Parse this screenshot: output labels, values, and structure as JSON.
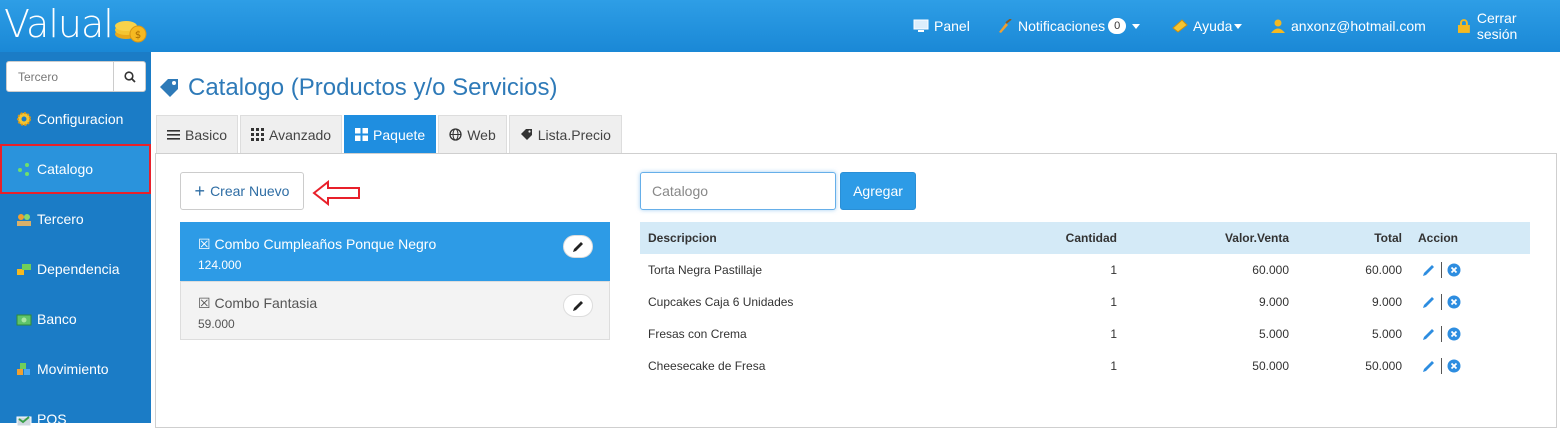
{
  "app": {
    "logo_text": "Valual"
  },
  "topnav": {
    "panel": "Panel",
    "notifications": "Notificaciones",
    "notifications_count": "0",
    "help": "Ayuda",
    "user": "anxonz@hotmail.com",
    "logout": "Cerrar sesión"
  },
  "sidebar": {
    "search_placeholder": "Tercero",
    "items": [
      {
        "label": "Configuracion",
        "icon": "gear-icon"
      },
      {
        "label": "Catalogo",
        "icon": "nodes-icon",
        "active": true
      },
      {
        "label": "Tercero",
        "icon": "people-icon"
      },
      {
        "label": "Dependencia",
        "icon": "blocks-icon"
      },
      {
        "label": "Banco",
        "icon": "bank-icon"
      },
      {
        "label": "Movimiento",
        "icon": "cubes-icon"
      },
      {
        "label": "POS",
        "icon": "pos-icon"
      }
    ]
  },
  "page": {
    "title": "Catalogo (Productos y/o Servicios)"
  },
  "tabs": [
    {
      "label": "Basico",
      "icon": "list-icon"
    },
    {
      "label": "Avanzado",
      "icon": "grid-icon"
    },
    {
      "label": "Paquete",
      "icon": "dashboard-icon",
      "active": true
    },
    {
      "label": "Web",
      "icon": "globe-icon"
    },
    {
      "label": "Lista.Precio",
      "icon": "tag-icon"
    }
  ],
  "packages": {
    "create_label": "Crear Nuevo",
    "items": [
      {
        "name": "Combo Cumpleaños Ponque Negro",
        "price": "124.000",
        "selected": true
      },
      {
        "name": "Combo Fantasia",
        "price": "59.000",
        "selected": false
      }
    ]
  },
  "detail": {
    "catalog_placeholder": "Catalogo",
    "add_label": "Agregar",
    "columns": [
      "Descripcion",
      "Cantidad",
      "Valor.Venta",
      "Total",
      "Accion"
    ],
    "rows": [
      {
        "descripcion": "Torta Negra Pastillaje",
        "cantidad": "1",
        "valor": "60.000",
        "total": "60.000"
      },
      {
        "descripcion": "Cupcakes Caja 6 Unidades",
        "cantidad": "1",
        "valor": "9.000",
        "total": "9.000"
      },
      {
        "descripcion": "Fresas con Crema",
        "cantidad": "1",
        "valor": "5.000",
        "total": "5.000"
      },
      {
        "descripcion": "Cheesecake de Fresa",
        "cantidad": "1",
        "valor": "50.000",
        "total": "50.000"
      }
    ]
  },
  "colors": {
    "topbar": "#1a88d6",
    "sidebar": "#1b7cc6",
    "accent": "#2d9be6",
    "highlight": "#e8202a"
  }
}
